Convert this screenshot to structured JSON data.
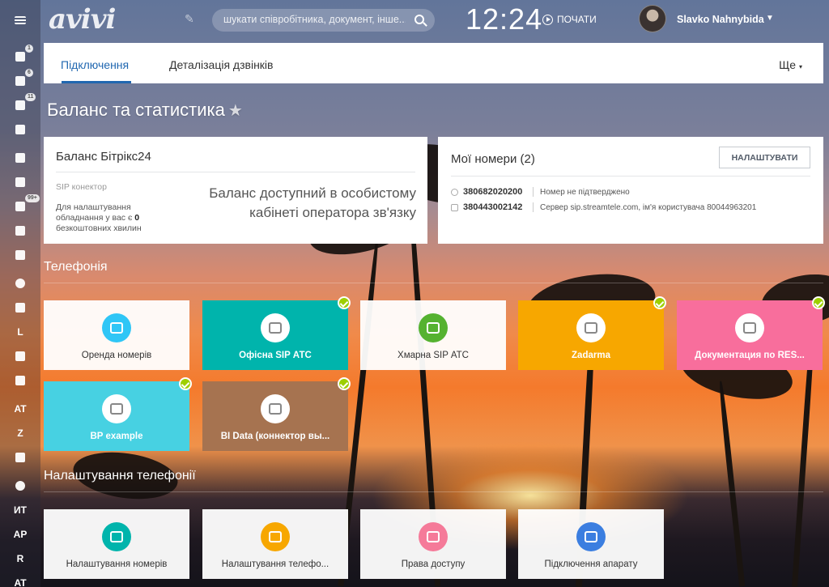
{
  "sidebar": {
    "items": [
      {
        "name": "menu-icon",
        "type": "icon",
        "badge": ""
      },
      {
        "name": "feed-icon",
        "type": "icon",
        "badge": "1"
      },
      {
        "name": "tasks-icon",
        "type": "icon",
        "badge": "6"
      },
      {
        "name": "chat-icon",
        "type": "icon",
        "badge": "11"
      },
      {
        "name": "drive-icon",
        "type": "icon",
        "badge": ""
      },
      {
        "name": "calendar-icon",
        "type": "icon",
        "badge": ""
      },
      {
        "name": "mail-icon",
        "type": "icon",
        "badge": ""
      },
      {
        "name": "filter-icon",
        "type": "icon",
        "badge": "99+"
      },
      {
        "name": "window-icon",
        "type": "icon",
        "badge": ""
      },
      {
        "name": "users-icon",
        "type": "icon",
        "badge": ""
      },
      {
        "name": "clock-icon",
        "type": "icon",
        "badge": ""
      },
      {
        "name": "contact-card-icon",
        "type": "icon",
        "badge": ""
      },
      {
        "name": "sidebar-item-l",
        "type": "text",
        "label": "L"
      },
      {
        "name": "cart-icon",
        "type": "icon",
        "badge": ""
      },
      {
        "name": "grid-icon",
        "type": "icon",
        "badge": ""
      },
      {
        "name": "sidebar-item-at",
        "type": "text",
        "label": "AT"
      },
      {
        "name": "sidebar-item-z",
        "type": "text",
        "label": "Z"
      },
      {
        "name": "analytics-icon",
        "type": "icon",
        "badge": ""
      },
      {
        "name": "pie-icon",
        "type": "icon",
        "badge": ""
      },
      {
        "name": "sidebar-item-it",
        "type": "text",
        "label": "ИТ"
      },
      {
        "name": "sidebar-item-ap",
        "type": "text",
        "label": "AP"
      },
      {
        "name": "sidebar-item-r",
        "type": "text",
        "label": "R"
      },
      {
        "name": "sidebar-item-at2",
        "type": "text",
        "label": "AT"
      }
    ]
  },
  "header": {
    "logo": "avivi",
    "search_placeholder": "шукати співробітника, документ, інше...",
    "clock": "12:24",
    "start_label": "ПОЧАТИ",
    "user_name": "Slavko Nahnybida"
  },
  "tabs": {
    "items": [
      "Підключення",
      "Деталізація дзвінків"
    ],
    "more": "Ще"
  },
  "page_title": "Баланс та статистика",
  "balance": {
    "title": "Баланс Бітрікс24",
    "sip_label": "SIP конектор",
    "note_prefix": "Для налаштування обладнання у вас є ",
    "note_count": "0",
    "note_suffix": " безкоштовних хвилин",
    "info": "Баланс доступний в особистому кабінеті оператора зв'язку"
  },
  "numbers": {
    "title": "Мої номери (2)",
    "setup_label": "НАЛАШТУВАТИ",
    "rows": [
      {
        "number": "380682020200",
        "status": "Номер не підтверджено"
      },
      {
        "number": "380443002142",
        "status": "Сервер sip.streamtele.com, ім'я користувача 80044963201"
      }
    ]
  },
  "telephony": {
    "title": "Телефонія",
    "tiles": [
      {
        "label": "Оренда номерів",
        "style": "light",
        "color": "#2fc6f6",
        "checked": false
      },
      {
        "label": "Офісна SIP АТС",
        "style": "colored",
        "color": "#00b4ac",
        "checked": true
      },
      {
        "label": "Хмарна SIP АТС",
        "style": "light",
        "color": "#55b230",
        "checked": false
      },
      {
        "label": "Zadarma",
        "style": "colored",
        "color": "#f7a700",
        "checked": true
      },
      {
        "label": "Документация по RES...",
        "style": "colored",
        "color": "#f86e9c",
        "checked": true
      },
      {
        "label": "BP example",
        "style": "colored",
        "color": "#47d1e2",
        "checked": true
      },
      {
        "label": "BI Data (коннектор вы...",
        "style": "colored",
        "color": "#a67350",
        "checked": true
      }
    ]
  },
  "telephony_settings": {
    "title": "Налаштування телефонії",
    "tiles": [
      {
        "label": "Налаштування номерів",
        "color": "#00b4ac"
      },
      {
        "label": "Налаштування телефо...",
        "color": "#f7a700"
      },
      {
        "label": "Права доступу",
        "color": "#f57a99"
      },
      {
        "label": "Підключення апарату",
        "color": "#3b7ee0"
      }
    ]
  }
}
